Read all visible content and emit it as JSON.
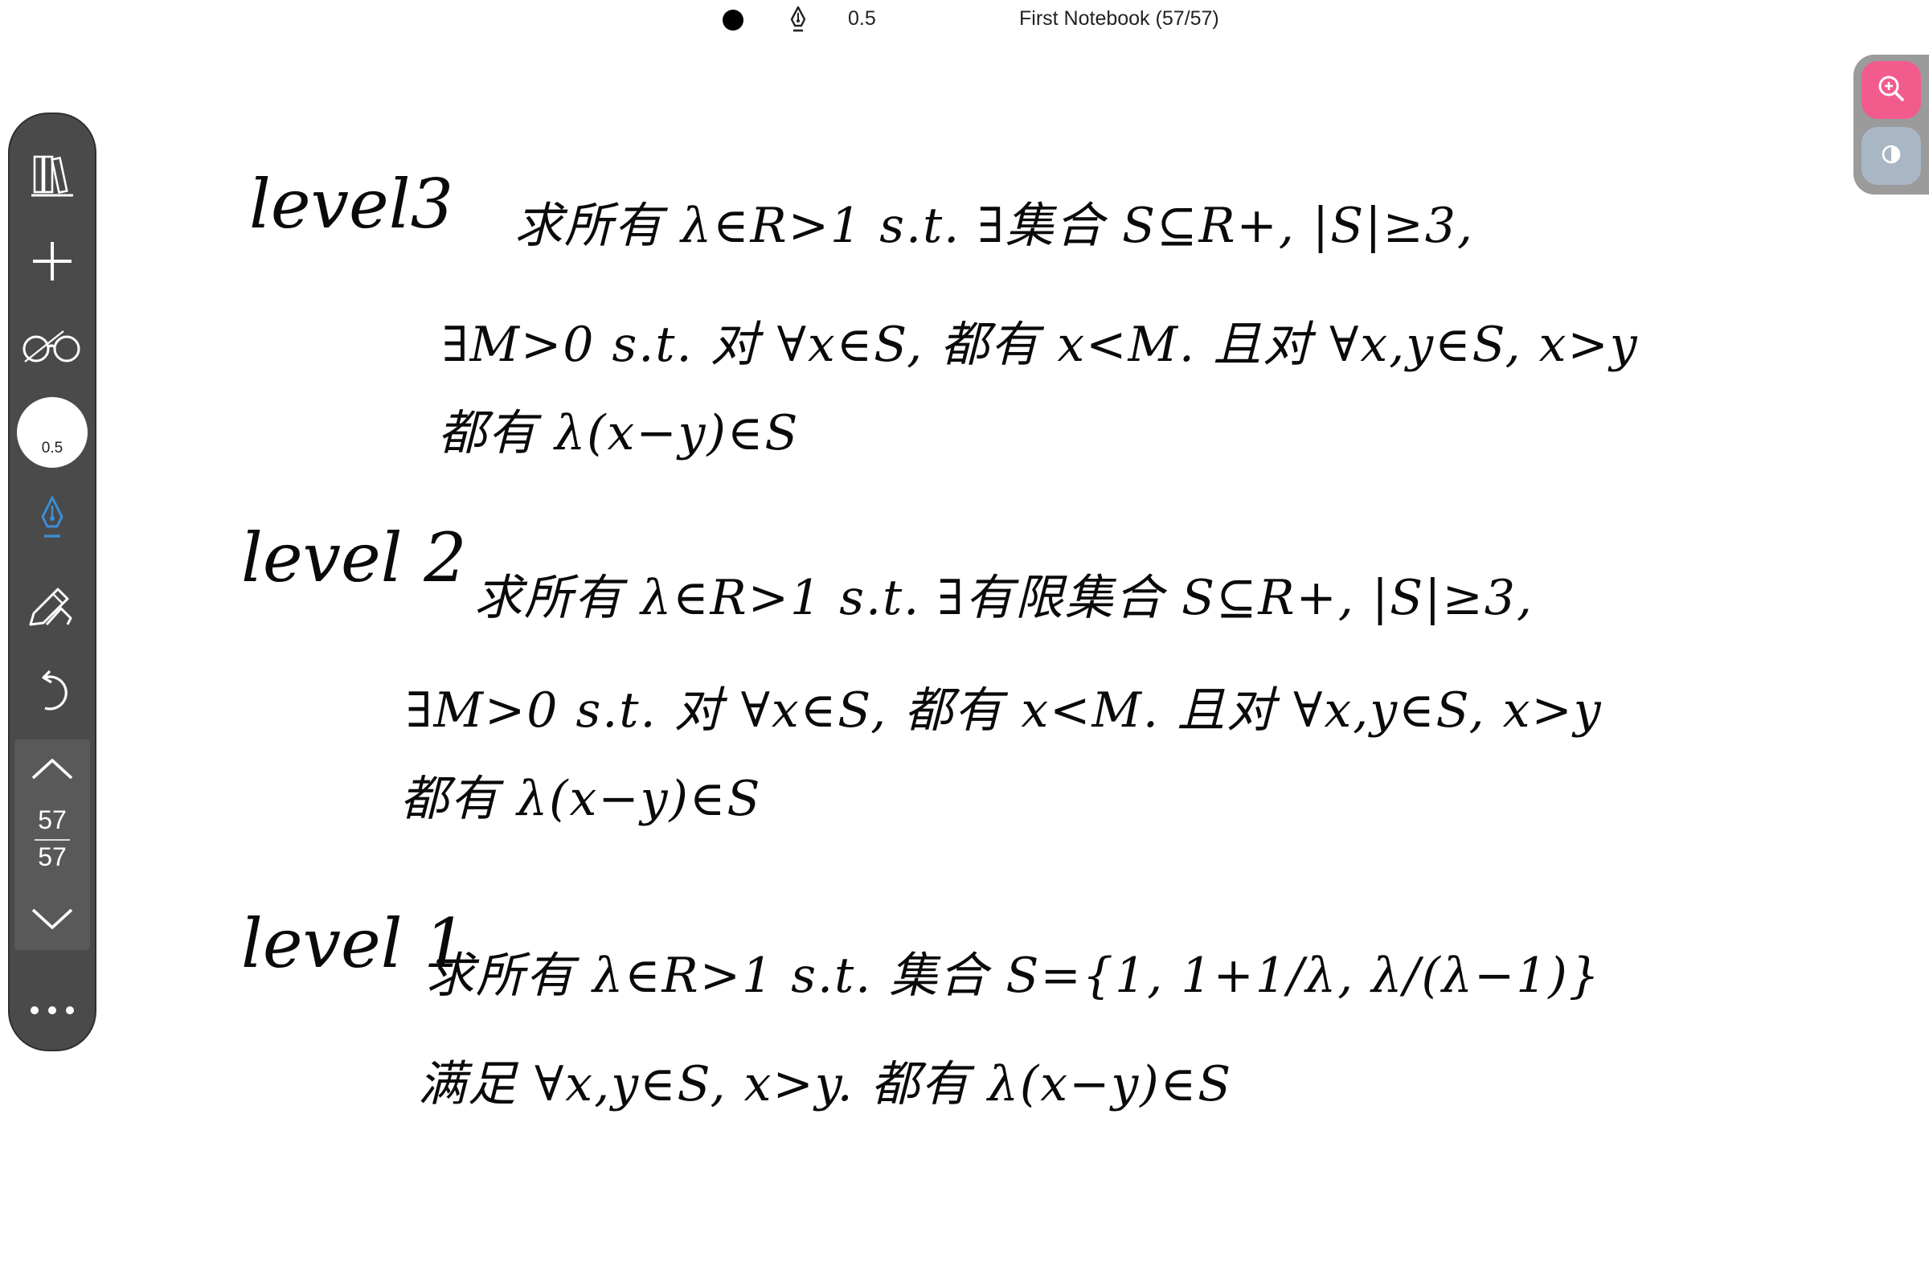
{
  "topbar": {
    "pen_size": "0.5",
    "notebook_title": "First Notebook (57/57)"
  },
  "rail": {
    "items": [
      {
        "name": "library",
        "icon": "books-icon"
      },
      {
        "name": "add",
        "icon": "plus-icon"
      },
      {
        "name": "view",
        "icon": "glasses-icon"
      },
      {
        "name": "pen",
        "icon": "fountain-pen-icon"
      },
      {
        "name": "pencil",
        "icon": "pencil-icon"
      },
      {
        "name": "undo",
        "icon": "undo-icon"
      },
      {
        "name": "more",
        "icon": "more-icon"
      }
    ],
    "size_label": "0.5",
    "page_current": "57",
    "page_total": "57",
    "active_color": "#3a8fd6"
  },
  "right_panel": {
    "zoom_icon": "zoom-in-icon",
    "contrast_icon": "contrast-icon",
    "zoom_color": "#f25c8d"
  },
  "handwriting": {
    "level3": {
      "label": "level3",
      "line1": "求所有 λ∈R>1  s.t. ∃集合 S⊆R+, |S|≥3,",
      "line2": "∃M>0 s.t. 对 ∀x∈S, 都有 x<M. 且对 ∀x,y∈S, x>y",
      "line3": "都有 λ(x−y)∈S"
    },
    "level2": {
      "label": "level 2",
      "line1": "求所有 λ∈R>1  s.t. ∃有限集合 S⊆R+, |S|≥3,",
      "line2": "∃M>0 s.t. 对 ∀x∈S, 都有 x<M. 且对 ∀x,y∈S, x>y",
      "line3": "都有 λ(x−y)∈S"
    },
    "level1": {
      "label": "level 1",
      "line1": "求所有 λ∈R>1  s.t. 集合 S={1, 1+1/λ, λ/(λ−1)}",
      "line2": "满足 ∀x,y∈S, x>y. 都有 λ(x−y)∈S"
    }
  }
}
